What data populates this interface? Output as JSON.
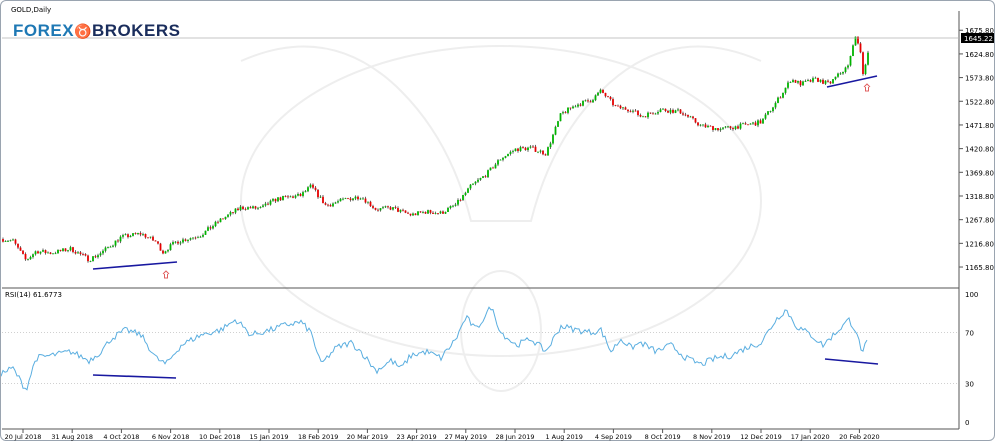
{
  "window_title": "GOLD,Daily",
  "logo": {
    "part1": "FOREX",
    "mark": "♉",
    "part2": "BROKERS"
  },
  "price_tags": {
    "current": "1645.22"
  },
  "rsi_label": "RSI(14) 61.6773",
  "colors": {
    "bull": "#00b400",
    "bear": "#e60000",
    "wick": "#000000",
    "rsi": "#5aaee0",
    "trendline": "#1818a0",
    "arrow": "#e06060",
    "grid": "#c8c8c8"
  },
  "chart_data": [
    {
      "type": "candlestick",
      "title": "GOLD,Daily",
      "ylim": [
        1140,
        1700
      ],
      "y_ticks": [
        "1675.80",
        "1624.80",
        "1573.80",
        "1522.80",
        "1471.80",
        "1420.80",
        "1369.80",
        "1318.80",
        "1267.80",
        "1216.80",
        "1165.80"
      ],
      "x_ticks": [
        "20 Jul 2018",
        "31 Aug 2018",
        "4 Oct 2018",
        "6 Nov 2018",
        "10 Dec 2018",
        "15 Jan 2019",
        "18 Feb 2019",
        "20 Mar 2019",
        "23 Apr 2019",
        "27 May 2019",
        "28 Jun 2019",
        "1 Aug 2019",
        "4 Sep 2019",
        "8 Oct 2019",
        "8 Nov 2019",
        "12 Dec 2019",
        "17 Jan 2020",
        "20 Feb 2020"
      ],
      "path": [
        [
          0,
          1226
        ],
        [
          12,
          1222
        ],
        [
          25,
          1180
        ],
        [
          35,
          1200
        ],
        [
          50,
          1196
        ],
        [
          70,
          1205
        ],
        [
          88,
          1182
        ],
        [
          100,
          1196
        ],
        [
          120,
          1230
        ],
        [
          140,
          1238
        ],
        [
          155,
          1220
        ],
        [
          162,
          1198
        ],
        [
          175,
          1220
        ],
        [
          200,
          1235
        ],
        [
          220,
          1268
        ],
        [
          240,
          1294
        ],
        [
          260,
          1292
        ],
        [
          275,
          1312
        ],
        [
          300,
          1320
        ],
        [
          310,
          1340
        ],
        [
          325,
          1298
        ],
        [
          345,
          1312
        ],
        [
          360,
          1318
        ],
        [
          375,
          1290
        ],
        [
          390,
          1293
        ],
        [
          410,
          1278
        ],
        [
          425,
          1285
        ],
        [
          440,
          1282
        ],
        [
          455,
          1300
        ],
        [
          470,
          1340
        ],
        [
          485,
          1365
        ],
        [
          500,
          1400
        ],
        [
          515,
          1420
        ],
        [
          530,
          1422
        ],
        [
          545,
          1410
        ],
        [
          560,
          1495
        ],
        [
          575,
          1515
        ],
        [
          590,
          1525
        ],
        [
          600,
          1545
        ],
        [
          615,
          1510
        ],
        [
          630,
          1505
        ],
        [
          640,
          1490
        ],
        [
          660,
          1505
        ],
        [
          680,
          1500
        ],
        [
          700,
          1470
        ],
        [
          720,
          1463
        ],
        [
          740,
          1470
        ],
        [
          760,
          1478
        ],
        [
          775,
          1520
        ],
        [
          790,
          1570
        ],
        [
          800,
          1560
        ],
        [
          815,
          1570
        ],
        [
          828,
          1560
        ],
        [
          840,
          1585
        ],
        [
          848,
          1600
        ],
        [
          853,
          1660
        ],
        [
          858,
          1650
        ],
        [
          862,
          1580
        ],
        [
          866,
          1620
        ],
        [
          869,
          1645
        ]
      ],
      "current_price": 1645.22
    },
    {
      "type": "line",
      "title": "RSI(14) 61.6773",
      "ylim": [
        0,
        100
      ],
      "y_ticks": [
        "100",
        "70",
        "30",
        "0"
      ],
      "path": [
        [
          0,
          38
        ],
        [
          12,
          42
        ],
        [
          25,
          25
        ],
        [
          35,
          50
        ],
        [
          50,
          52
        ],
        [
          70,
          55
        ],
        [
          88,
          48
        ],
        [
          100,
          55
        ],
        [
          110,
          65
        ],
        [
          125,
          72
        ],
        [
          140,
          68
        ],
        [
          155,
          50
        ],
        [
          165,
          45
        ],
        [
          180,
          60
        ],
        [
          200,
          68
        ],
        [
          220,
          72
        ],
        [
          235,
          80
        ],
        [
          250,
          68
        ],
        [
          270,
          72
        ],
        [
          285,
          76
        ],
        [
          300,
          78
        ],
        [
          310,
          70
        ],
        [
          320,
          45
        ],
        [
          335,
          58
        ],
        [
          350,
          62
        ],
        [
          360,
          55
        ],
        [
          375,
          40
        ],
        [
          390,
          48
        ],
        [
          400,
          42
        ],
        [
          410,
          52
        ],
        [
          425,
          55
        ],
        [
          440,
          50
        ],
        [
          455,
          65
        ],
        [
          465,
          82
        ],
        [
          475,
          72
        ],
        [
          490,
          90
        ],
        [
          500,
          70
        ],
        [
          515,
          60
        ],
        [
          530,
          65
        ],
        [
          545,
          55
        ],
        [
          560,
          75
        ],
        [
          575,
          72
        ],
        [
          590,
          70
        ],
        [
          600,
          72
        ],
        [
          610,
          55
        ],
        [
          620,
          65
        ],
        [
          630,
          58
        ],
        [
          640,
          62
        ],
        [
          655,
          55
        ],
        [
          670,
          60
        ],
        [
          685,
          50
        ],
        [
          700,
          45
        ],
        [
          715,
          50
        ],
        [
          730,
          52
        ],
        [
          745,
          58
        ],
        [
          760,
          62
        ],
        [
          775,
          80
        ],
        [
          785,
          88
        ],
        [
          795,
          75
        ],
        [
          810,
          68
        ],
        [
          822,
          60
        ],
        [
          835,
          70
        ],
        [
          848,
          80
        ],
        [
          856,
          70
        ],
        [
          860,
          55
        ],
        [
          866,
          61.68
        ]
      ],
      "current_value": 61.6773
    }
  ]
}
